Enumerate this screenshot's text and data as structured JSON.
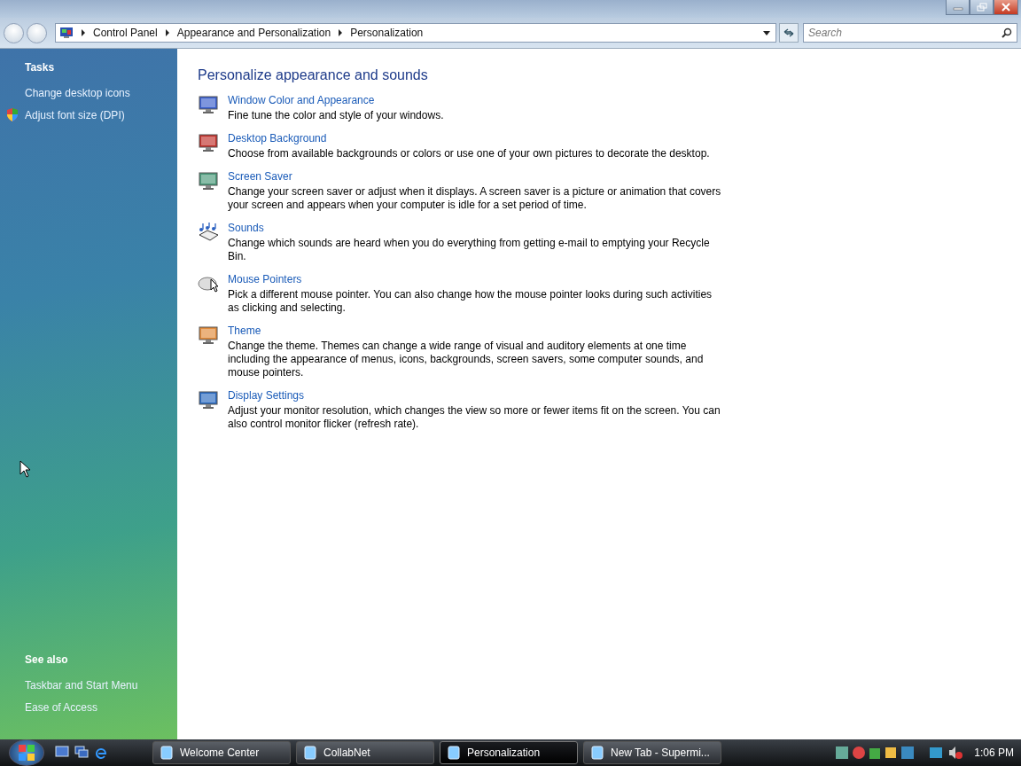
{
  "address_bar": {
    "breadcrumb": [
      "Control Panel",
      "Appearance and Personalization",
      "Personalization"
    ]
  },
  "search": {
    "placeholder": "Search"
  },
  "sidebar": {
    "tasks_heading": "Tasks",
    "tasks": [
      {
        "label": "Change desktop icons",
        "kind": "link"
      },
      {
        "label": "Adjust font size (DPI)",
        "kind": "shield"
      }
    ],
    "see_also_heading": "See also",
    "see_also": [
      {
        "label": "Taskbar and Start Menu"
      },
      {
        "label": "Ease of Access"
      }
    ]
  },
  "content": {
    "heading": "Personalize appearance and sounds",
    "items": [
      {
        "title": "Window Color and Appearance",
        "description": "Fine tune the color and style of your windows."
      },
      {
        "title": "Desktop Background",
        "description": "Choose from available backgrounds or colors or use one of your own pictures to decorate the desktop."
      },
      {
        "title": "Screen Saver",
        "description": "Change your screen saver or adjust when it displays. A screen saver is a picture or animation that covers your screen and appears when your computer is idle for a set period of time."
      },
      {
        "title": "Sounds",
        "description": "Change which sounds are heard when you do everything from getting e-mail to emptying your Recycle Bin."
      },
      {
        "title": "Mouse Pointers",
        "description": "Pick a different mouse pointer. You can also change how the mouse pointer looks during such activities as clicking and selecting."
      },
      {
        "title": "Theme",
        "description": "Change the theme. Themes can change a wide range of visual and auditory elements at one time including the appearance of menus, icons, backgrounds, screen savers, some computer sounds, and mouse pointers."
      },
      {
        "title": "Display Settings",
        "description": "Adjust your monitor resolution, which changes the view so more or fewer items fit on the screen. You can also control monitor flicker (refresh rate)."
      }
    ]
  },
  "taskbar": {
    "windows": [
      {
        "label": "Welcome Center",
        "selected": false
      },
      {
        "label": "CollabNet",
        "selected": false
      },
      {
        "label": "Personalization",
        "selected": true
      },
      {
        "label": "New Tab - Supermi...",
        "selected": false
      }
    ],
    "clock": "1:06 PM"
  }
}
